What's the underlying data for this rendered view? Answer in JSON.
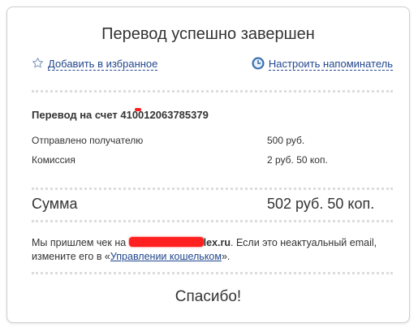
{
  "title": "Перевод успешно завершен",
  "links": {
    "favorite": "Добавить в избранное",
    "reminder": "Настроить напоминатель"
  },
  "icons": {
    "favorite": "star-icon",
    "reminder": "clock-icon"
  },
  "transfer": {
    "label": "Перевод на счет 410012063785379"
  },
  "rows": [
    {
      "label": "Отправлено получателю",
      "value": "500 руб."
    },
    {
      "label": "Комиссия",
      "value": "2 руб. 50 коп."
    }
  ],
  "sum": {
    "label": "Сумма",
    "value": "502 руб. 50 коп."
  },
  "notice": {
    "prefix": "Мы пришлем чек на ",
    "email_visible_suffix": "lex.ru",
    "middle": ". Если это неактуальный email, измените его в «",
    "link": "Управлении кошельком",
    "suffix": "»."
  },
  "thanks": "Спасибо!",
  "colors": {
    "link": "#22478e",
    "text": "#333333",
    "separator": "#dcdcdc",
    "redaction": "#ff2020"
  }
}
